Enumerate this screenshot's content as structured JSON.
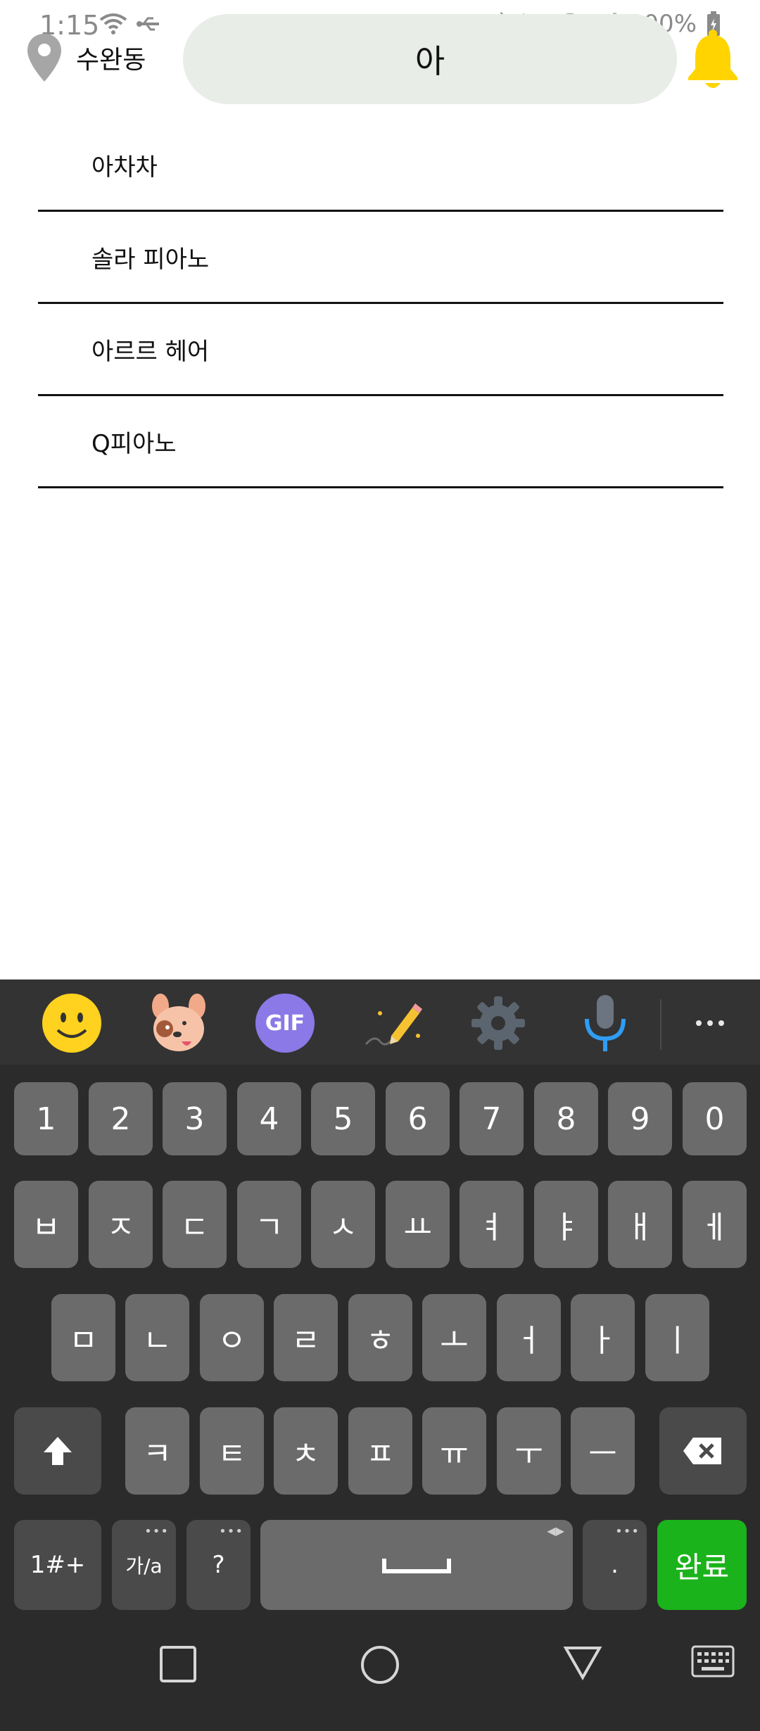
{
  "status": {
    "time": "1:15",
    "battery": "100%"
  },
  "header": {
    "location": "수완동",
    "search_value": "아"
  },
  "results": [
    {
      "label": "아차차"
    },
    {
      "label": "솔라 피아노"
    },
    {
      "label": "아르르 헤어"
    },
    {
      "label": "Q피아노"
    }
  ],
  "keyboard": {
    "toolbar": {
      "gif_label": "GIF"
    },
    "row_numbers": [
      "1",
      "2",
      "3",
      "4",
      "5",
      "6",
      "7",
      "8",
      "9",
      "0"
    ],
    "row1": [
      "ㅂ",
      "ㅈ",
      "ㄷ",
      "ㄱ",
      "ㅅ",
      "ㅛ",
      "ㅕ",
      "ㅑ",
      "ㅐ",
      "ㅔ"
    ],
    "row2": [
      "ㅁ",
      "ㄴ",
      "ㅇ",
      "ㄹ",
      "ㅎ",
      "ㅗ",
      "ㅓ",
      "ㅏ",
      "ㅣ"
    ],
    "row3": [
      "ㅋ",
      "ㅌ",
      "ㅊ",
      "ㅍ",
      "ㅠ",
      "ㅜ",
      "ㅡ"
    ],
    "bottom": {
      "symbols_label": "1#+",
      "lang_label": "가/a",
      "question_label": "?",
      "period_label": ".",
      "done_label": "완료"
    }
  },
  "colors": {
    "search_bg": "#e8ede7",
    "bell": "#ffd400",
    "done": "#1bb31b",
    "keyboard_bg": "#2b2b2b"
  }
}
